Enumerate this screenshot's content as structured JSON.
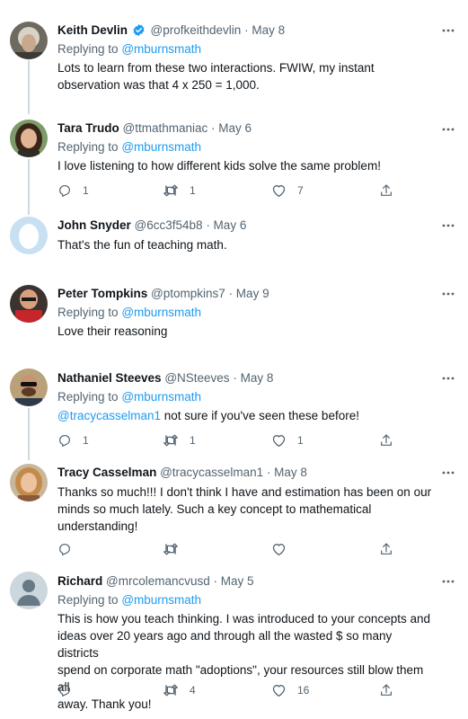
{
  "colors": {
    "link": "#1d9bf0",
    "verified": "#1d9bf0",
    "muted": "#536471",
    "thread_line": "#cfd9de"
  },
  "icons": {
    "reply": "reply-icon",
    "retweet": "retweet-icon",
    "like": "like-icon",
    "share": "share-icon",
    "more": "more-icon",
    "verified": "verified-badge-icon"
  },
  "tweets": [
    {
      "name": "Keith Devlin",
      "verified": true,
      "handle": "@profkeithdevlin",
      "date": "· May 8",
      "replying_prefix": "Replying to",
      "replying_handle": "@mburnsmath",
      "text": "Lots to learn from these two interactions. FWIW, my instant observation was that 4 x 250 = 1,000."
    },
    {
      "name": "Tara Trudo",
      "handle": "@ttmathmaniac",
      "date": "· May 6",
      "replying_prefix": "Replying to",
      "replying_handle": "@mburnsmath",
      "text": "I love listening to how different kids solve the same problem!",
      "counts": {
        "replies": "1",
        "retweets": "1",
        "likes": "7"
      }
    },
    {
      "name": "John Snyder",
      "handle": "@6cc3f54b8",
      "date": "· May 6",
      "text": "That's the fun of teaching math."
    },
    {
      "name": "Peter Tompkins",
      "handle": "@ptompkins7",
      "date": "· May 9",
      "replying_prefix": "Replying to",
      "replying_handle": "@mburnsmath",
      "text": "Love their reasoning"
    },
    {
      "name": "Nathaniel Steeves",
      "handle": "@NSteeves",
      "date": "· May 8",
      "replying_prefix": "Replying to",
      "replying_handle": "@mburnsmath",
      "mention": "@tracycasselman1",
      "text": " not sure if you've seen these before!",
      "counts": {
        "replies": "1",
        "retweets": "1",
        "likes": "1"
      }
    },
    {
      "name": "Tracy Casselman",
      "handle": "@tracycasselman1",
      "date": "· May 8",
      "text_lines": [
        "Thanks so much!!! I don't think I have and estimation has been on our",
        "minds so much lately. Such a key concept to mathematical",
        "understanding!"
      ],
      "counts": {
        "replies": "",
        "retweets": "",
        "likes": ""
      }
    },
    {
      "name": "Richard",
      "handle": "@mrcolemancvusd",
      "date": "· May 5",
      "replying_prefix": "Replying to",
      "replying_handle": "@mburnsmath",
      "text_lines": [
        "This is how you teach thinking. I was introduced to your concepts and",
        "ideas over 20 years ago and through all the wasted $ so many districts",
        "spend on corporate math \"adoptions\", your resources still blow them all",
        "away. Thank you!"
      ],
      "counts": {
        "replies": "",
        "retweets": "4",
        "likes": "16"
      }
    }
  ]
}
